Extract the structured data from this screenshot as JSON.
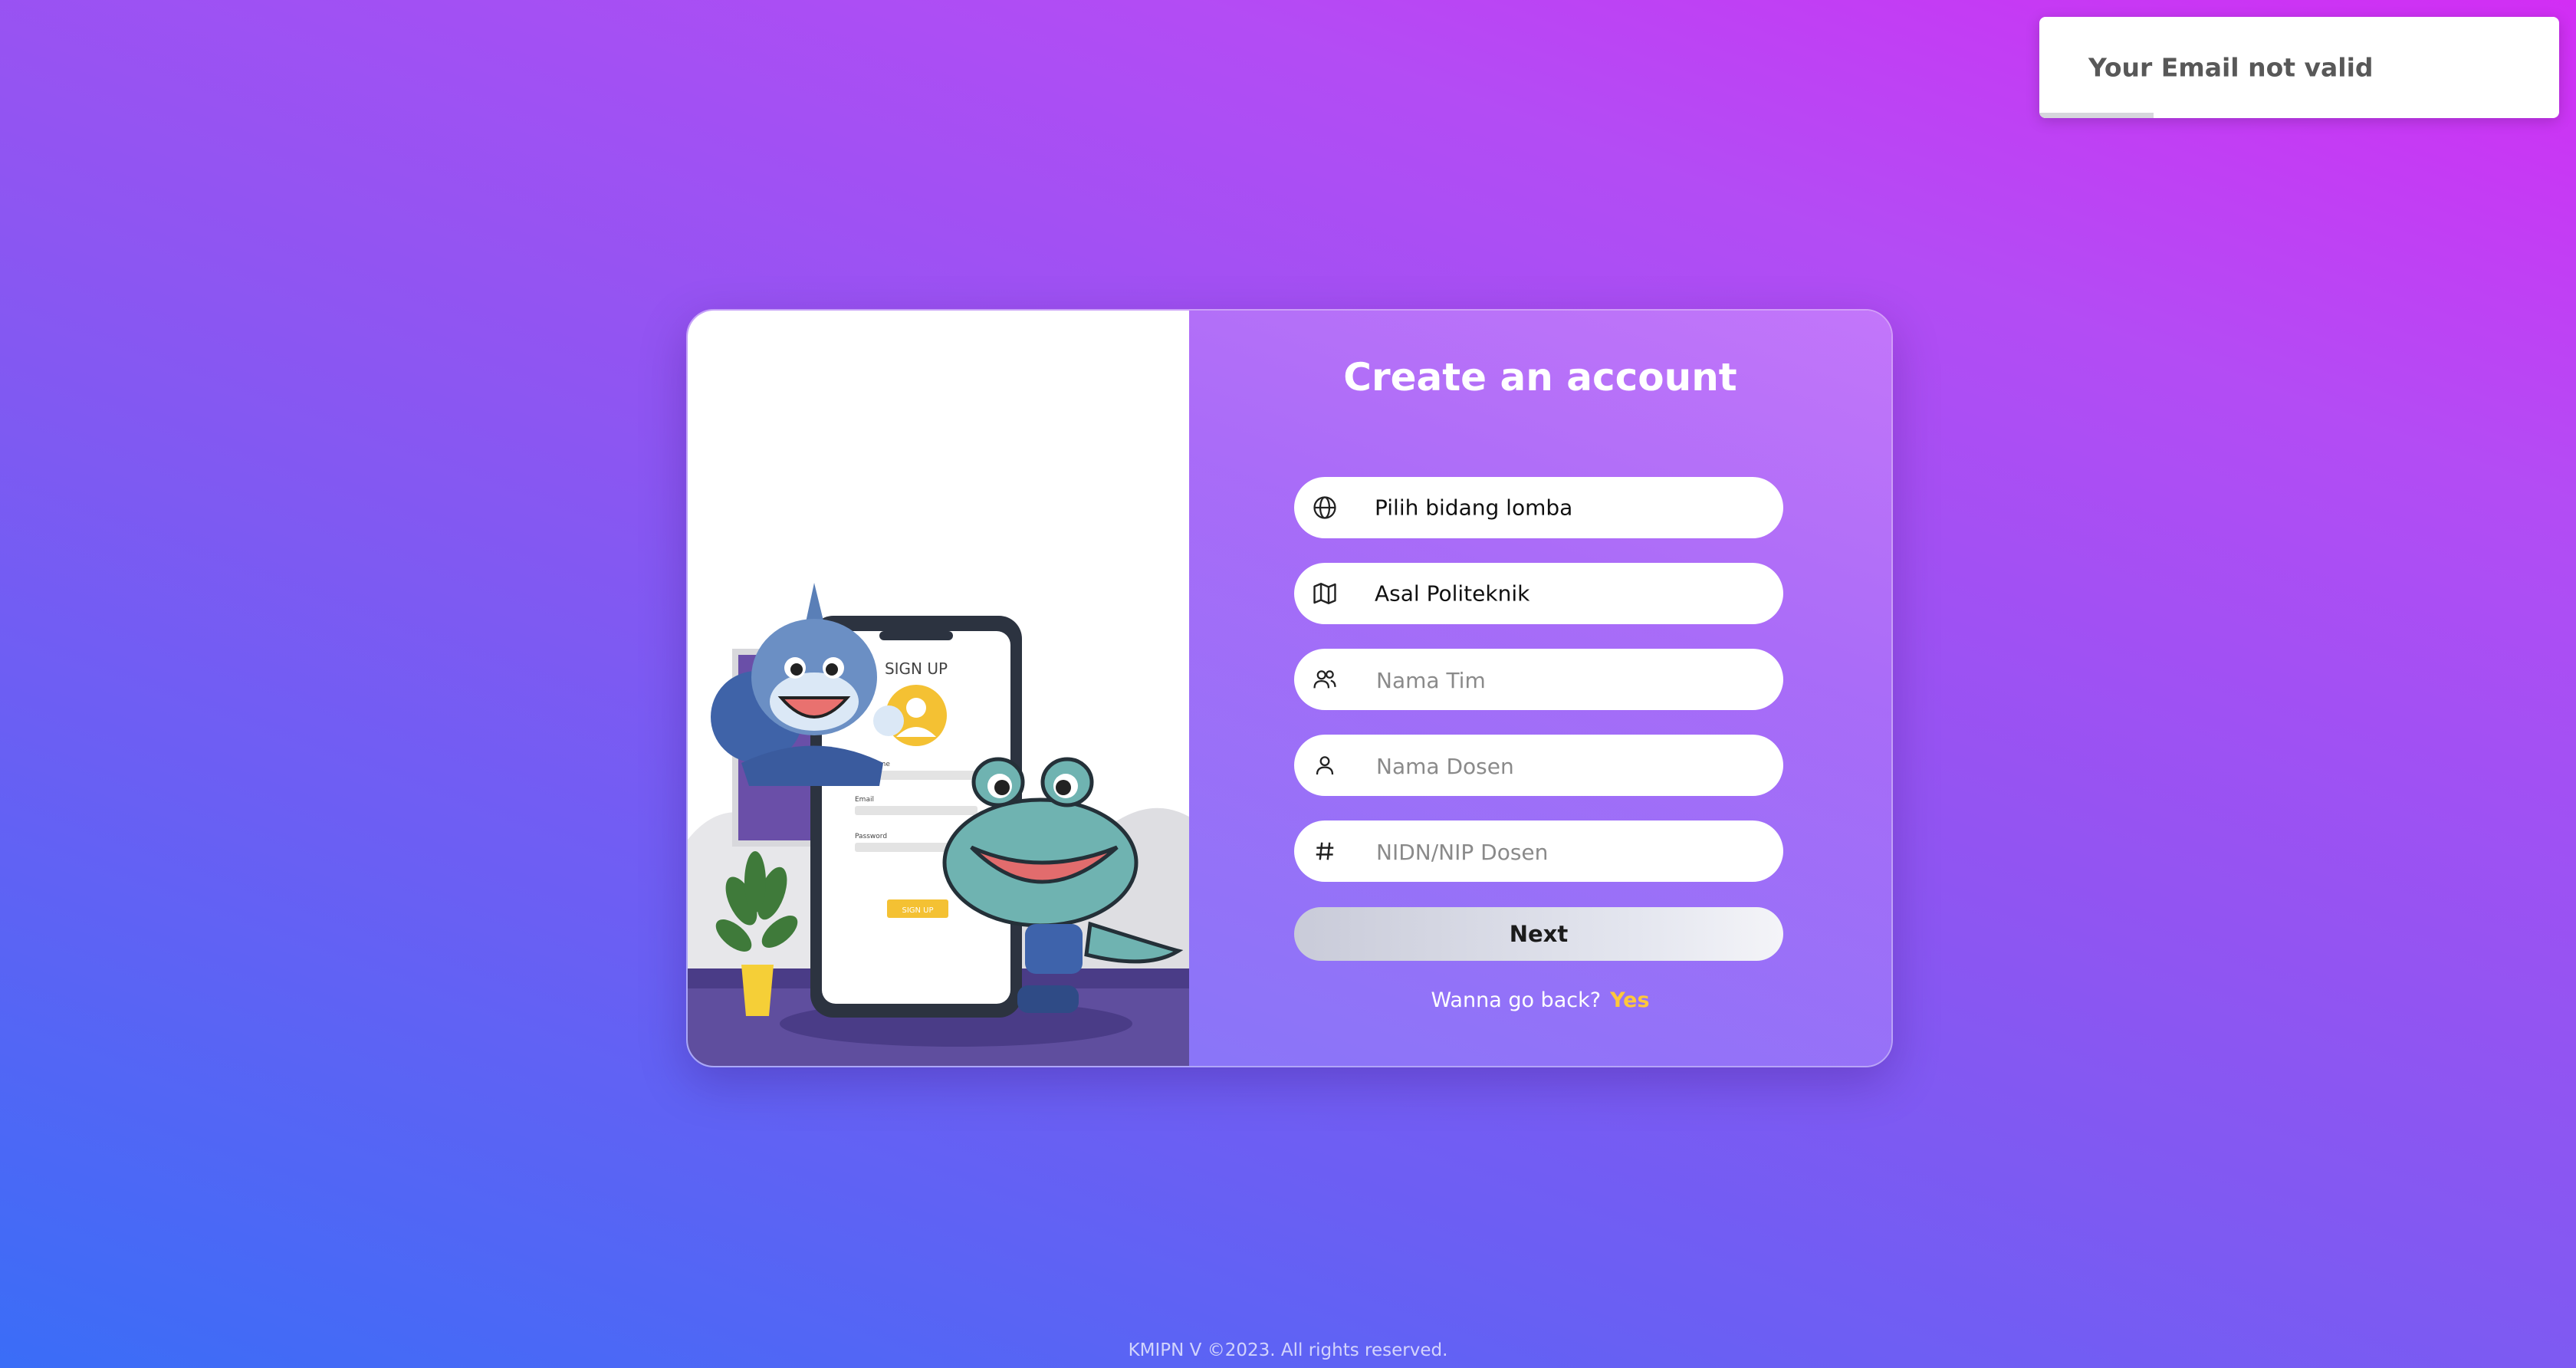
{
  "toast": {
    "message": "Your Email not valid",
    "progress_fraction": 0.22
  },
  "card": {
    "title": "Create an account",
    "illustration": {
      "phone_heading": "SIGN UP",
      "phone_labels": [
        "Username",
        "Email",
        "Password"
      ],
      "phone_button": "SIGN UP"
    },
    "fields": [
      {
        "icon": "globe-icon",
        "value": "Pilih bidang lomba",
        "kind": "select"
      },
      {
        "icon": "map-icon",
        "value": "Asal Politeknik",
        "kind": "select"
      },
      {
        "icon": "users-icon",
        "placeholder": "Nama Tim",
        "kind": "input"
      },
      {
        "icon": "user-icon",
        "placeholder": "Nama Dosen",
        "kind": "input"
      },
      {
        "icon": "hash-icon",
        "placeholder": "NIDN/NIP Dosen",
        "kind": "input"
      }
    ],
    "next_label": "Next",
    "back_prompt": "Wanna go back?",
    "back_link": "Yes"
  },
  "footer": "KMIPN V ©2023. All rights reserved.",
  "colors": {
    "accent_link": "#ffc83a",
    "bg_top": "#d22ef4",
    "bg_bottom": "#3a6df7"
  }
}
